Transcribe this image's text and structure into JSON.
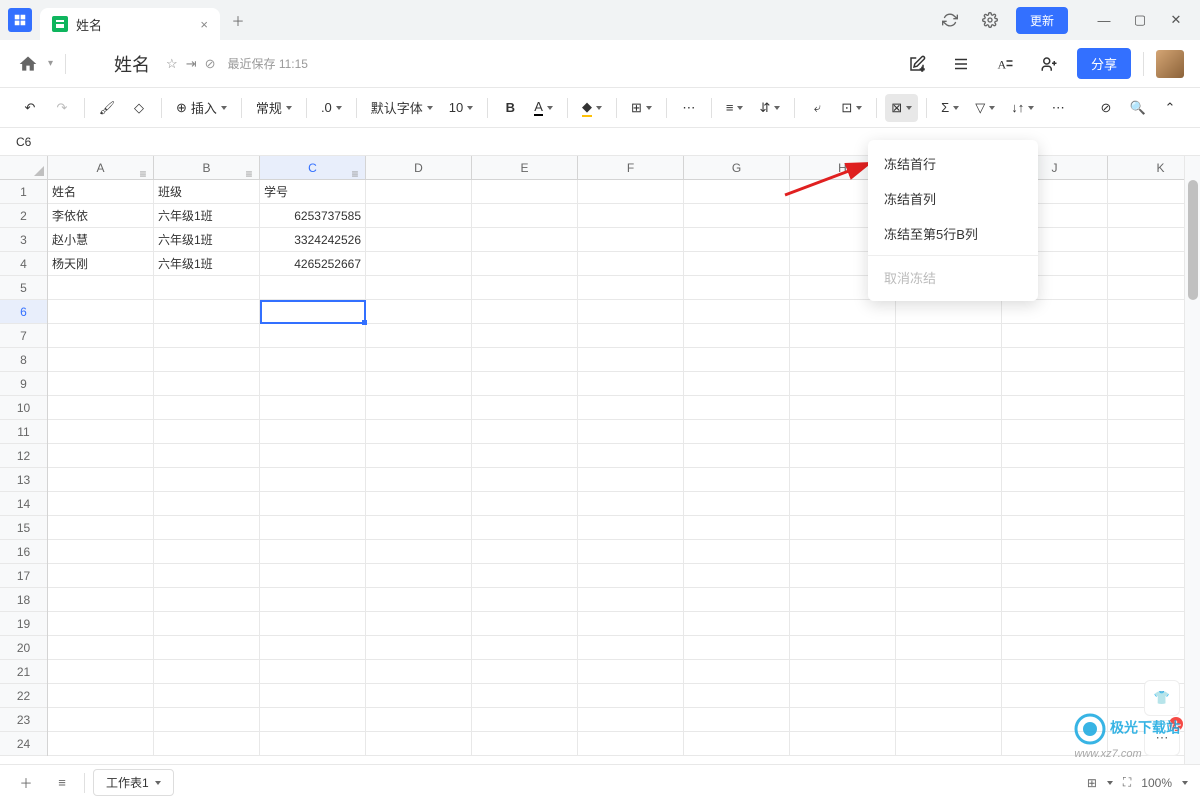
{
  "titlebar": {
    "tab_title": "姓名",
    "update_label": "更新"
  },
  "header": {
    "doc_title": "姓名",
    "save_status": "最近保存 11:15",
    "share_label": "分享"
  },
  "toolbar": {
    "insert_label": "插入",
    "format_label": "常规",
    "decimal_label": ".0",
    "font_label": "默认字体",
    "font_size": "10"
  },
  "namebox": {
    "cell_ref": "C6"
  },
  "columns": [
    "A",
    "B",
    "C",
    "D",
    "E",
    "F",
    "G",
    "H",
    "I",
    "J",
    "K"
  ],
  "rows": [
    "1",
    "2",
    "3",
    "4",
    "5",
    "6",
    "7",
    "8",
    "9",
    "10",
    "11",
    "12",
    "13",
    "14",
    "15",
    "16",
    "17",
    "18",
    "19",
    "20",
    "21",
    "22",
    "23",
    "24"
  ],
  "grid_data": {
    "headers": {
      "A": "姓名",
      "B": "班级",
      "C": "学号"
    },
    "r2": {
      "A": "李依依",
      "B": "六年级1班",
      "C": "6253737585"
    },
    "r3": {
      "A": "赵小慧",
      "B": "六年级1班",
      "C": "3324242526"
    },
    "r4": {
      "A": "杨天刚",
      "B": "六年级1班",
      "C": "4265252667"
    }
  },
  "freeze_menu": {
    "first_row": "冻结首行",
    "first_col": "冻结首列",
    "freeze_to": "冻结至第5行B列",
    "unfreeze": "取消冻结"
  },
  "statusbar": {
    "sheet_name": "工作表1",
    "zoom": "100%"
  },
  "watermark": {
    "line1": "极光下载站",
    "line2": "www.xz7.com"
  },
  "side": {
    "badge": "1"
  }
}
